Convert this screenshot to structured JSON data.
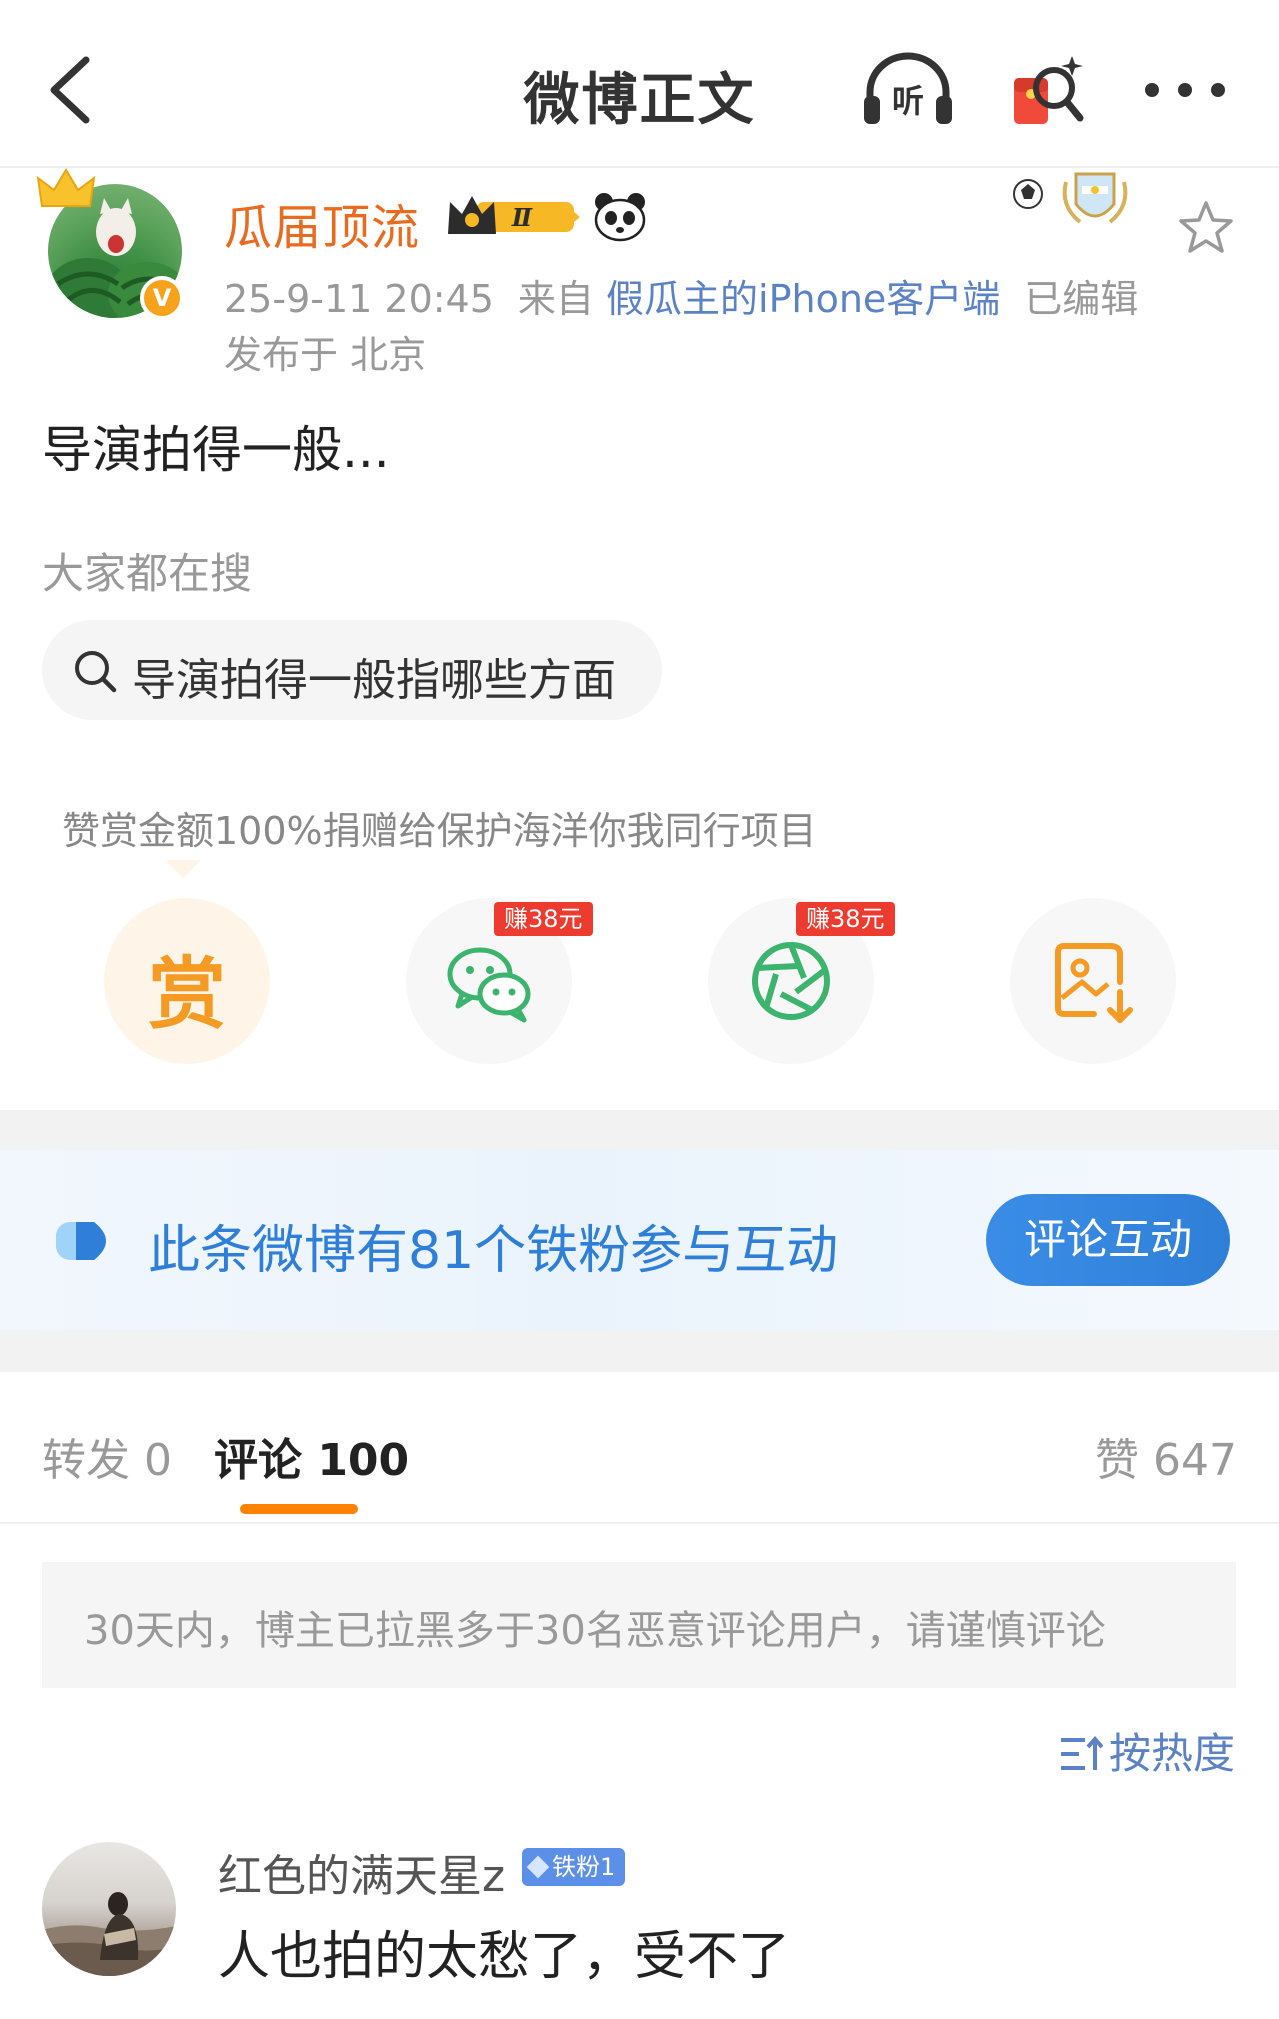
{
  "header": {
    "title": "微博正文",
    "listen_label": "听"
  },
  "post": {
    "author_name": "瓜届顶流",
    "level_badge": "Ⅱ",
    "verify_mark": "V",
    "timestamp": "25-9-11 20:45",
    "source_prefix": "来自",
    "source": "假瓜主的iPhone客户端",
    "edited": "已编辑",
    "location": "发布于 北京",
    "text": "导演拍得一般..."
  },
  "search": {
    "heading": "大家都在搜",
    "chip": "导演拍得一般指哪些方面"
  },
  "reward": {
    "note": "赞赏金额100%捐赠给保护海洋你我同行项目",
    "reward_glyph": "赏",
    "earn_tag_wechat": "赚38元",
    "earn_tag_moments": "赚38元"
  },
  "fans_banner": {
    "text": "此条微博有81个铁粉参与互动",
    "button": "评论互动"
  },
  "tabs": {
    "repost": "转发 0",
    "comment": "评论 100",
    "like": "赞 647"
  },
  "notice": "30天内，博主已拉黑多于30名恶意评论用户，请谨慎评论",
  "sort_label": "按热度",
  "comments": [
    {
      "name": "红色的满天星z",
      "badge": "铁粉1",
      "text": "人也拍的太愁了，受不了"
    }
  ],
  "colors": {
    "accent_orange": "#ff8200",
    "name_orange": "#e86b1f",
    "link_blue": "#5b82c4",
    "banner_blue": "#2f7fd8",
    "wechat_green": "#3cb46e",
    "tag_red": "#ee3b2f"
  },
  "icons": [
    "back-icon",
    "headphones-icon",
    "red-packet-icon",
    "more-icon",
    "crown-icon",
    "panda-icon",
    "football-icon",
    "star-icon",
    "search-icon",
    "wechat-icon",
    "moments-icon",
    "save-image-icon",
    "fans-icon",
    "sort-icon"
  ]
}
